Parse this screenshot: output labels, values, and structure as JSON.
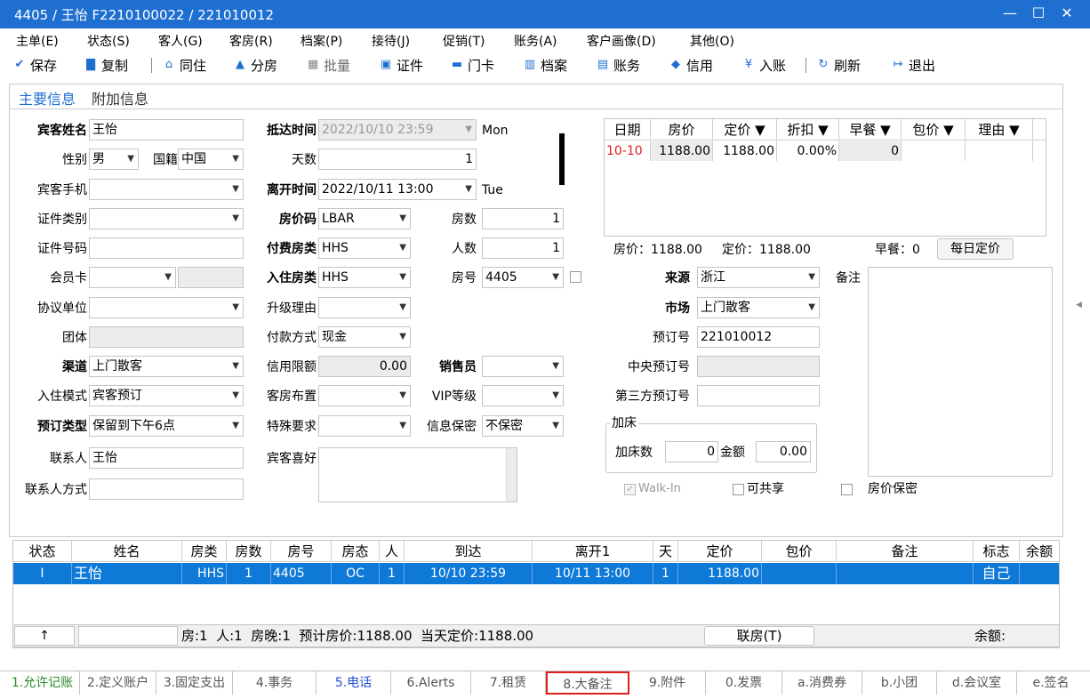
{
  "window": {
    "title": "4405 / 王怡 F2210100022 / 221010012",
    "min": "—",
    "max": "☐",
    "close": "✕"
  },
  "menu": [
    "主单(E)",
    "状态(S)",
    "客人(G)",
    "客房(R)",
    "档案(P)",
    "接待(J)",
    "促销(T)",
    "账务(A)",
    "客户画像(D)",
    "其他(O)"
  ],
  "toolbar": {
    "save": "保存",
    "copy": "复制",
    "share": "同住",
    "assign": "分房",
    "batch": "批量",
    "id": "证件",
    "card": "门卡",
    "profile": "档案",
    "account": "账务",
    "credit": "信用",
    "post": "入账",
    "refresh": "刷新",
    "exit": "退出"
  },
  "tabs": {
    "main": "主要信息",
    "extra": "附加信息"
  },
  "form": {
    "guest_name_label": "宾客姓名",
    "guest_name": "王怡",
    "gender_label": "性别",
    "gender": "男",
    "nationality_label": "国籍",
    "nationality": "中国",
    "mobile_label": "宾客手机",
    "id_type_label": "证件类别",
    "id_no_label": "证件号码",
    "member_label": "会员卡",
    "agreement_label": "协议单位",
    "group_label": "团体",
    "channel_label": "渠道",
    "channel": "上门散客",
    "checkin_mode_label": "入住模式",
    "checkin_mode": "宾客预订",
    "booking_type_label": "预订类型",
    "booking_type": "保留到下午6点",
    "contact_label": "联系人",
    "contact": "王怡",
    "contact_method_label": "联系人方式",
    "arrival_label": "抵达时间",
    "arrival": "2022/10/10 23:59",
    "arrival_day": "Mon",
    "nights_label": "天数",
    "nights": "1",
    "departure_label": "离开时间",
    "departure": "2022/10/11 13:00",
    "departure_day": "Tue",
    "rate_code_label": "房价码",
    "rate_code": "LBAR",
    "rooms_label": "房数",
    "rooms": "1",
    "pay_type_label": "付费房类",
    "pay_type": "HHS",
    "persons_label": "人数",
    "persons": "1",
    "room_type_label": "入住房类",
    "room_type": "HHS",
    "room_no_label": "房号",
    "room_no": "4405",
    "upgrade_label": "升级理由",
    "pay_method_label": "付款方式",
    "pay_method": "现金",
    "credit_label": "信用限额",
    "credit": "0.00",
    "sales_label": "销售员",
    "layout_label": "客房布置",
    "vip_label": "VIP等级",
    "special_label": "特殊要求",
    "privacy_label": "信息保密",
    "privacy": "不保密",
    "pref_label": "宾客喜好",
    "source_label": "来源",
    "source": "浙江",
    "market_label": "市场",
    "market": "上门散客",
    "booking_no_label": "预订号",
    "booking_no": "221010012",
    "central_label": "中央预订号",
    "third_label": "第三方预订号",
    "note_label": "备注",
    "extra_bed_title": "加床",
    "extra_bed_label": "加床数",
    "extra_bed": "0",
    "amount_label": "金额",
    "amount": "0.00",
    "walkin": "Walk-In",
    "shared": "可共享",
    "rate_secret": "房价保密"
  },
  "rate_grid": {
    "headers": [
      "日期",
      "房价",
      "定价 ▼",
      "折扣 ▼",
      "早餐 ▼",
      "包价 ▼",
      "理由 ▼"
    ],
    "row": [
      "10-10",
      "1188.00",
      "1188.00",
      "0.00%",
      "0",
      "",
      ""
    ],
    "summary_rate": "房价：1188.00",
    "summary_fixed": "定价：1188.00",
    "summary_breakfast": "早餐：0",
    "daily_btn": "每日定价"
  },
  "guest_grid": {
    "headers": [
      "状态",
      "姓名",
      "房类",
      "房数",
      "房号",
      "房态",
      "人",
      "到达",
      "离开1",
      "天",
      "定价",
      "包价",
      "备注",
      "标志",
      "余额"
    ],
    "row": [
      "I",
      "王怡",
      "HHS",
      "1",
      "4405",
      "OC",
      "1",
      "10/10 23:59",
      "10/11 13:00",
      "1",
      "1188.00",
      "",
      "",
      "自己",
      ""
    ],
    "footer_arrow": "↑",
    "footer_summary": "房:1  人:1  房晚:1  预计房价:1188.00  当天定价:1188.00",
    "link_btn": "联房(T)",
    "balance_label": "余额:"
  },
  "bottom_tabs": [
    "1.允许记账",
    "2.定义账户",
    "3.固定支出",
    "4.事务",
    "5.电话",
    "6.Alerts",
    "7.租赁",
    "8.大备注",
    "9.附件",
    "0.发票",
    "a.消费券",
    "b.小团",
    "d.会议室",
    "e.签名"
  ],
  "colors": {
    "accent": "#1f6fd1",
    "highlight": "#e0201c",
    "selected": "#0f79d8"
  }
}
